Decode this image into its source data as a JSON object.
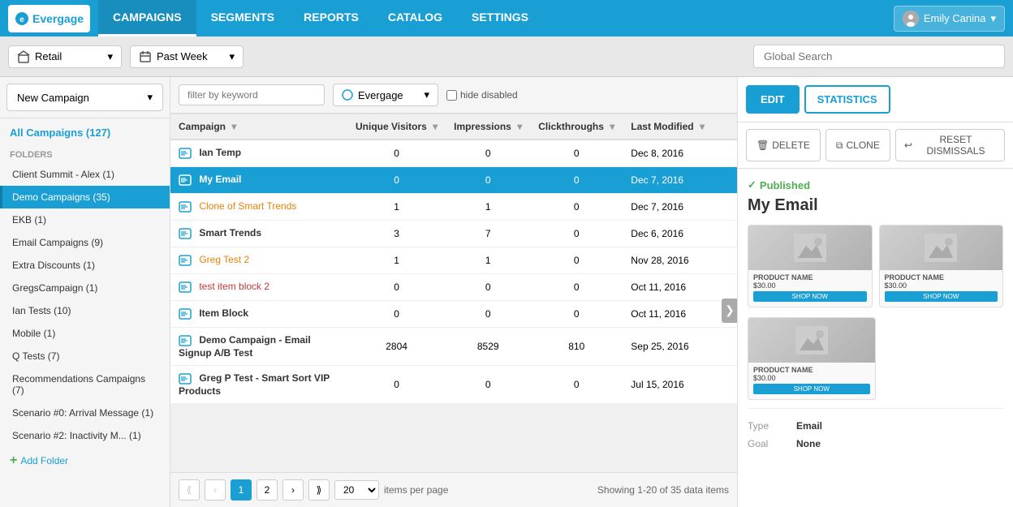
{
  "nav": {
    "logo": "evergage",
    "links": [
      "CAMPAIGNS",
      "SEGMENTS",
      "REPORTS",
      "CATALOG",
      "SETTINGS"
    ],
    "active_link": "CAMPAIGNS",
    "user": "Emily Canina"
  },
  "toolbar": {
    "retail_label": "Retail",
    "period_label": "Past Week",
    "global_search_placeholder": "Global Search"
  },
  "sidebar": {
    "new_campaign_label": "New Campaign",
    "all_campaigns_label": "All Campaigns (127)",
    "folders_label": "Folders",
    "add_folder_label": "Add Folder",
    "folders": [
      {
        "label": "Client Summit - Alex (1)"
      },
      {
        "label": "Demo Campaigns (35)",
        "active": true
      },
      {
        "label": "EKB (1)"
      },
      {
        "label": "Email Campaigns (9)"
      },
      {
        "label": "Extra Discounts (1)"
      },
      {
        "label": "GregsCampaign (1)"
      },
      {
        "label": "Ian Tests (10)"
      },
      {
        "label": "Mobile (1)"
      },
      {
        "label": "Q Tests (7)"
      },
      {
        "label": "Recommendations Campaigns (7)"
      },
      {
        "label": "Scenario #0: Arrival Message (1)"
      },
      {
        "label": "Scenario #2: Inactivity M... (1)"
      }
    ]
  },
  "filter": {
    "keyword_placeholder": "filter by keyword",
    "evergage_label": "Evergage",
    "hide_disabled_label": "hide disabled"
  },
  "table": {
    "columns": [
      "Campaign",
      "Unique Visitors",
      "Impressions",
      "Clickthroughs",
      "Last Modified"
    ],
    "rows": [
      {
        "icon": "email",
        "name": "Ian Temp",
        "unique_visitors": 0,
        "impressions": 0,
        "clickthroughs": 0,
        "last_modified": "Dec 8, 2016",
        "selected": false,
        "link_color": "normal"
      },
      {
        "icon": "email",
        "name": "My Email",
        "unique_visitors": 0,
        "impressions": 0,
        "clickthroughs": 0,
        "last_modified": "Dec 7, 2016",
        "selected": true,
        "link_color": "normal"
      },
      {
        "icon": "email",
        "name": "Clone of Smart Trends",
        "unique_visitors": 1,
        "impressions": 1,
        "clickthroughs": 0,
        "last_modified": "Dec 7, 2016",
        "selected": false,
        "link_color": "orange"
      },
      {
        "icon": "email",
        "name": "Smart Trends",
        "unique_visitors": 3,
        "impressions": 7,
        "clickthroughs": 0,
        "last_modified": "Dec 6, 2016",
        "selected": false,
        "link_color": "normal"
      },
      {
        "icon": "email",
        "name": "Greg Test 2",
        "unique_visitors": 1,
        "impressions": 1,
        "clickthroughs": 0,
        "last_modified": "Nov 28, 2016",
        "selected": false,
        "link_color": "orange"
      },
      {
        "icon": "email",
        "name": "test item block 2",
        "unique_visitors": 0,
        "impressions": 0,
        "clickthroughs": 0,
        "last_modified": "Oct 11, 2016",
        "selected": false,
        "link_color": "red"
      },
      {
        "icon": "email",
        "name": "Item Block",
        "unique_visitors": 0,
        "impressions": 0,
        "clickthroughs": 0,
        "last_modified": "Oct 11, 2016",
        "selected": false,
        "link_color": "normal"
      },
      {
        "icon": "email",
        "name": "Demo Campaign - Email Signup A/B Test",
        "unique_visitors": 2804,
        "impressions": 8529,
        "clickthroughs": 810,
        "last_modified": "Sep 25, 2016",
        "selected": false,
        "link_color": "normal"
      },
      {
        "icon": "email",
        "name": "Greg P Test - Smart Sort VIP Products",
        "unique_visitors": 0,
        "impressions": 0,
        "clickthroughs": 0,
        "last_modified": "Jul 15, 2016",
        "selected": false,
        "link_color": "normal"
      }
    ]
  },
  "pagination": {
    "current_page": 1,
    "total_pages": 2,
    "per_page": 20,
    "showing": "Showing 1-20 of 35 data items"
  },
  "right_panel": {
    "edit_label": "EDIT",
    "statistics_label": "STATISTICS",
    "delete_label": "DELETE",
    "clone_label": "CLONE",
    "reset_label": "RESET DISMISSALS",
    "status": "Published",
    "campaign_name": "My Email",
    "type_label": "Type",
    "type_value": "Email",
    "goal_label": "Goal",
    "goal_value": "None"
  },
  "icons": {
    "dropdown_arrow": "▾",
    "chevron_right": "❯",
    "check": "✓",
    "trash": "🗑",
    "copy": "⧉",
    "undo": "↩",
    "plus": "+",
    "mountain": "⛰"
  }
}
